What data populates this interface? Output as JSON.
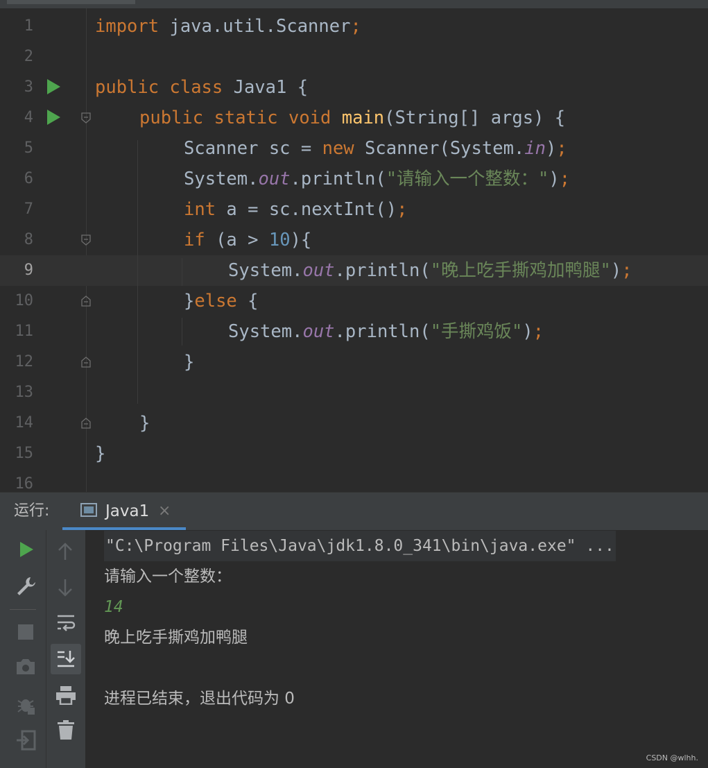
{
  "editor": {
    "line_numbers": [
      "1",
      "2",
      "3",
      "4",
      "5",
      "6",
      "7",
      "8",
      "9",
      "10",
      "11",
      "12",
      "13",
      "14",
      "15",
      "16"
    ],
    "current_line": "9",
    "code": {
      "l1": {
        "kw": "import",
        "rest": " java.util.Scanner",
        "semi": ";"
      },
      "l3": {
        "kw1": "public",
        "kw2": "class",
        "name": " Java1 {"
      },
      "l4": {
        "kw1": "public",
        "kw2": "static",
        "kw3": "void",
        "fn": "main",
        "rest": "(String[] args) {"
      },
      "l5": {
        "a": "Scanner sc = ",
        "kw": "new",
        "b": " Scanner(System.",
        "fld": "in",
        "c": ")",
        "semi": ";"
      },
      "l6": {
        "a": "System.",
        "fld": "out",
        "b": ".println(",
        "str": "\"请输入一个整数：\"",
        "c": ")",
        "semi": ";"
      },
      "l7": {
        "kw": "int",
        "a": " a = sc.nextInt()",
        "semi": ";"
      },
      "l8": {
        "kw": "if",
        "a": " (a > ",
        "num": "10",
        "b": "){"
      },
      "l9": {
        "a": "System.",
        "fld": "out",
        "b": ".println(",
        "str": "\"晚上吃手撕鸡加鸭腿\"",
        "c": ")",
        "semi": ";"
      },
      "l10": {
        "a": "}",
        "kw": "else",
        "b": " {"
      },
      "l11": {
        "a": "System.",
        "fld": "out",
        "b": ".println(",
        "str": "\"手撕鸡饭\"",
        "c": ")",
        "semi": ";"
      },
      "l12": {
        "a": "}"
      },
      "l14": {
        "a": "}"
      },
      "l15": {
        "a": "}"
      }
    }
  },
  "run_panel": {
    "label": "运行:",
    "tab_title": "Java1",
    "tab_close": "×",
    "output": [
      "\"C:\\Program Files\\Java\\jdk1.8.0_341\\bin\\java.exe\" ...",
      "请输入一个整数：",
      "14",
      "晚上吃手撕鸡加鸭腿",
      "",
      "进程已结束，退出代码为 0"
    ]
  },
  "watermark": "CSDN @wlhh."
}
